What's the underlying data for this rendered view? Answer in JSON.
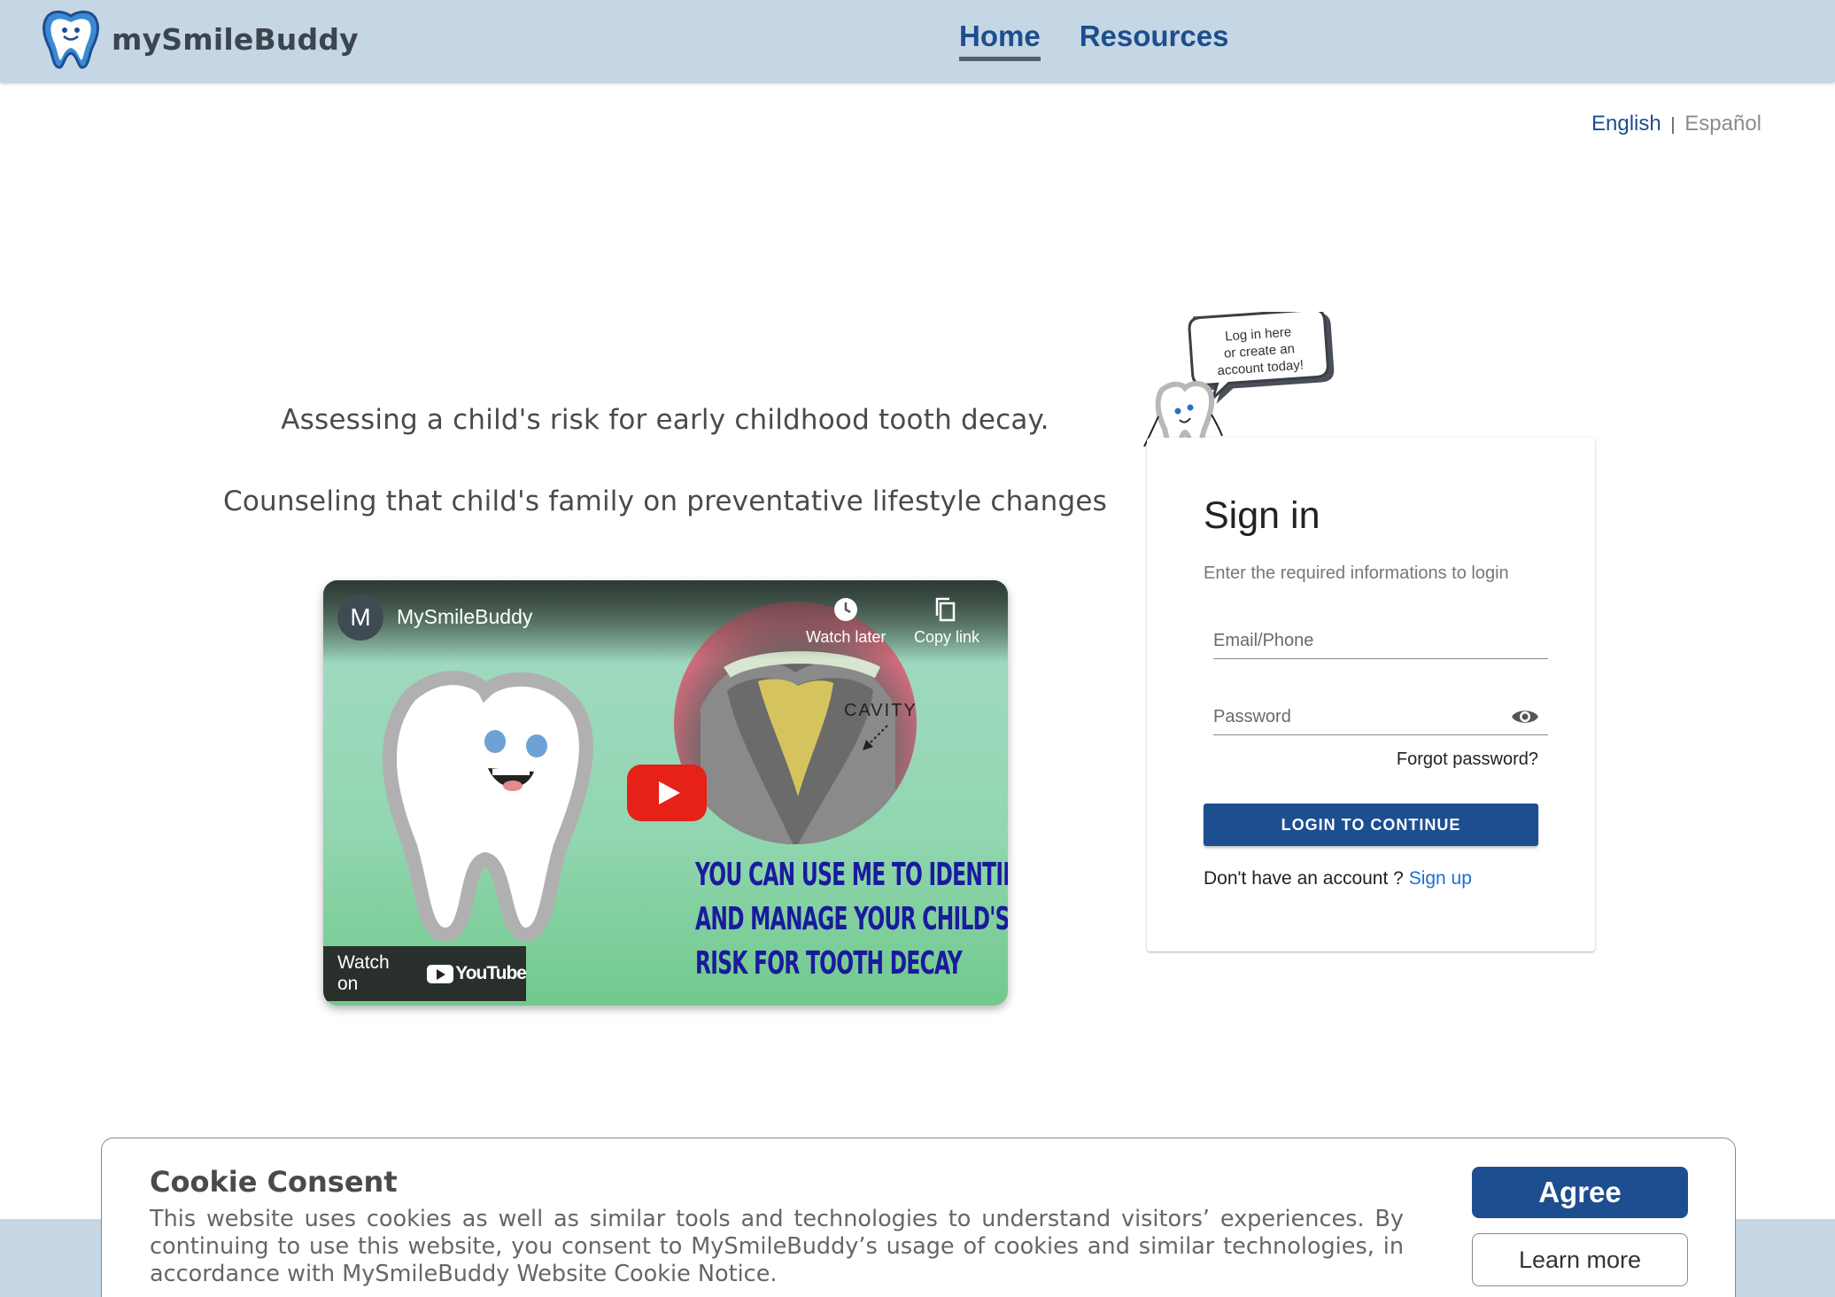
{
  "header": {
    "brand": "mySmileBuddy",
    "nav": [
      {
        "label": "Home",
        "active": true
      },
      {
        "label": "Resources",
        "active": false
      }
    ]
  },
  "language": {
    "english": "English",
    "separator": "|",
    "spanish": "Español"
  },
  "intro": {
    "line1": "Assessing a child's risk for early childhood tooth decay.",
    "line2": "Counseling that child's family on preventative lifestyle changes"
  },
  "video": {
    "channel_initial": "M",
    "channel_name": "MySmileBuddy",
    "watch_later": "Watch later",
    "copy_link": "Copy link",
    "cavity_label": "CAVITY",
    "caption_lines": [
      "YOU CAN USE ME TO IDENTIF",
      "AND MANAGE YOUR CHILD'S",
      "RISK FOR TOOTH DECAY"
    ],
    "watch_on": "Watch on",
    "youtube": "YouTube"
  },
  "mascot": {
    "speech": [
      "Log in here",
      "or create an",
      "account today!"
    ]
  },
  "signin": {
    "title": "Sign in",
    "subtitle": "Enter the required informations to login",
    "email_placeholder": "Email/Phone",
    "password_placeholder": "Password",
    "forgot": "Forgot password?",
    "login_button": "LOGIN TO CONTINUE",
    "no_account": "Don't have an account ?",
    "signup": "Sign up"
  },
  "cookie": {
    "title": "Cookie Consent",
    "text": "This website uses cookies as well as similar tools and technologies to understand visitors’ experiences. By continuing to use this website, you consent to MySmileBuddy’s usage of cookies and similar technologies, in accordance with MySmileBuddy Website Cookie Notice.",
    "agree": "Agree",
    "learn_more": "Learn more"
  },
  "colors": {
    "header_bg": "#c5d7e4",
    "primary": "#1d4e8f",
    "link": "#1a6fd6",
    "youtube_red": "#e62117"
  }
}
